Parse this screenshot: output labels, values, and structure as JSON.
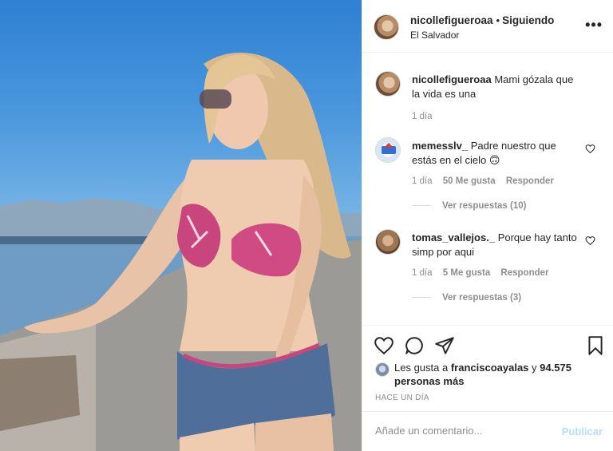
{
  "post": {
    "username": "nicollefigueroaa",
    "follow_status": "Siguiendo",
    "separator": "•",
    "location": "El Salvador",
    "more_icon": "more-options-icon",
    "image_icon": "photo-woman-bikini-mountain-view"
  },
  "caption": {
    "username": "nicollefigueroaa",
    "text": "Mami gózala que la vida es una",
    "time": "1 día"
  },
  "comments": [
    {
      "username": "memesslv_",
      "text": "Padre nuestro que estás en el cielo 🙃",
      "time": "1 día",
      "likes": "50 Me gusta",
      "reply": "Responder",
      "view_replies": "Ver respuestas (10)"
    },
    {
      "username": "tomas_vallejos._",
      "text": "Porque hay tanto simp por aqui",
      "time": "1 día",
      "likes": "5 Me gusta",
      "reply": "Responder",
      "view_replies": "Ver respuestas (3)"
    }
  ],
  "actions": {
    "liked_by_prefix": "Les gusta a",
    "liked_by_user": "franciscoayalas",
    "liked_by_suffix": "y",
    "likes_count": "94.575 personas más",
    "timestamp": "HACE UN DÍA"
  },
  "add_comment": {
    "placeholder": "Añade un comentario...",
    "publish_label": "Publicar"
  },
  "colors": {
    "text": "#262626",
    "muted": "#8e8e8e",
    "publish_disabled": "#b2dffc",
    "border": "#efefef"
  }
}
